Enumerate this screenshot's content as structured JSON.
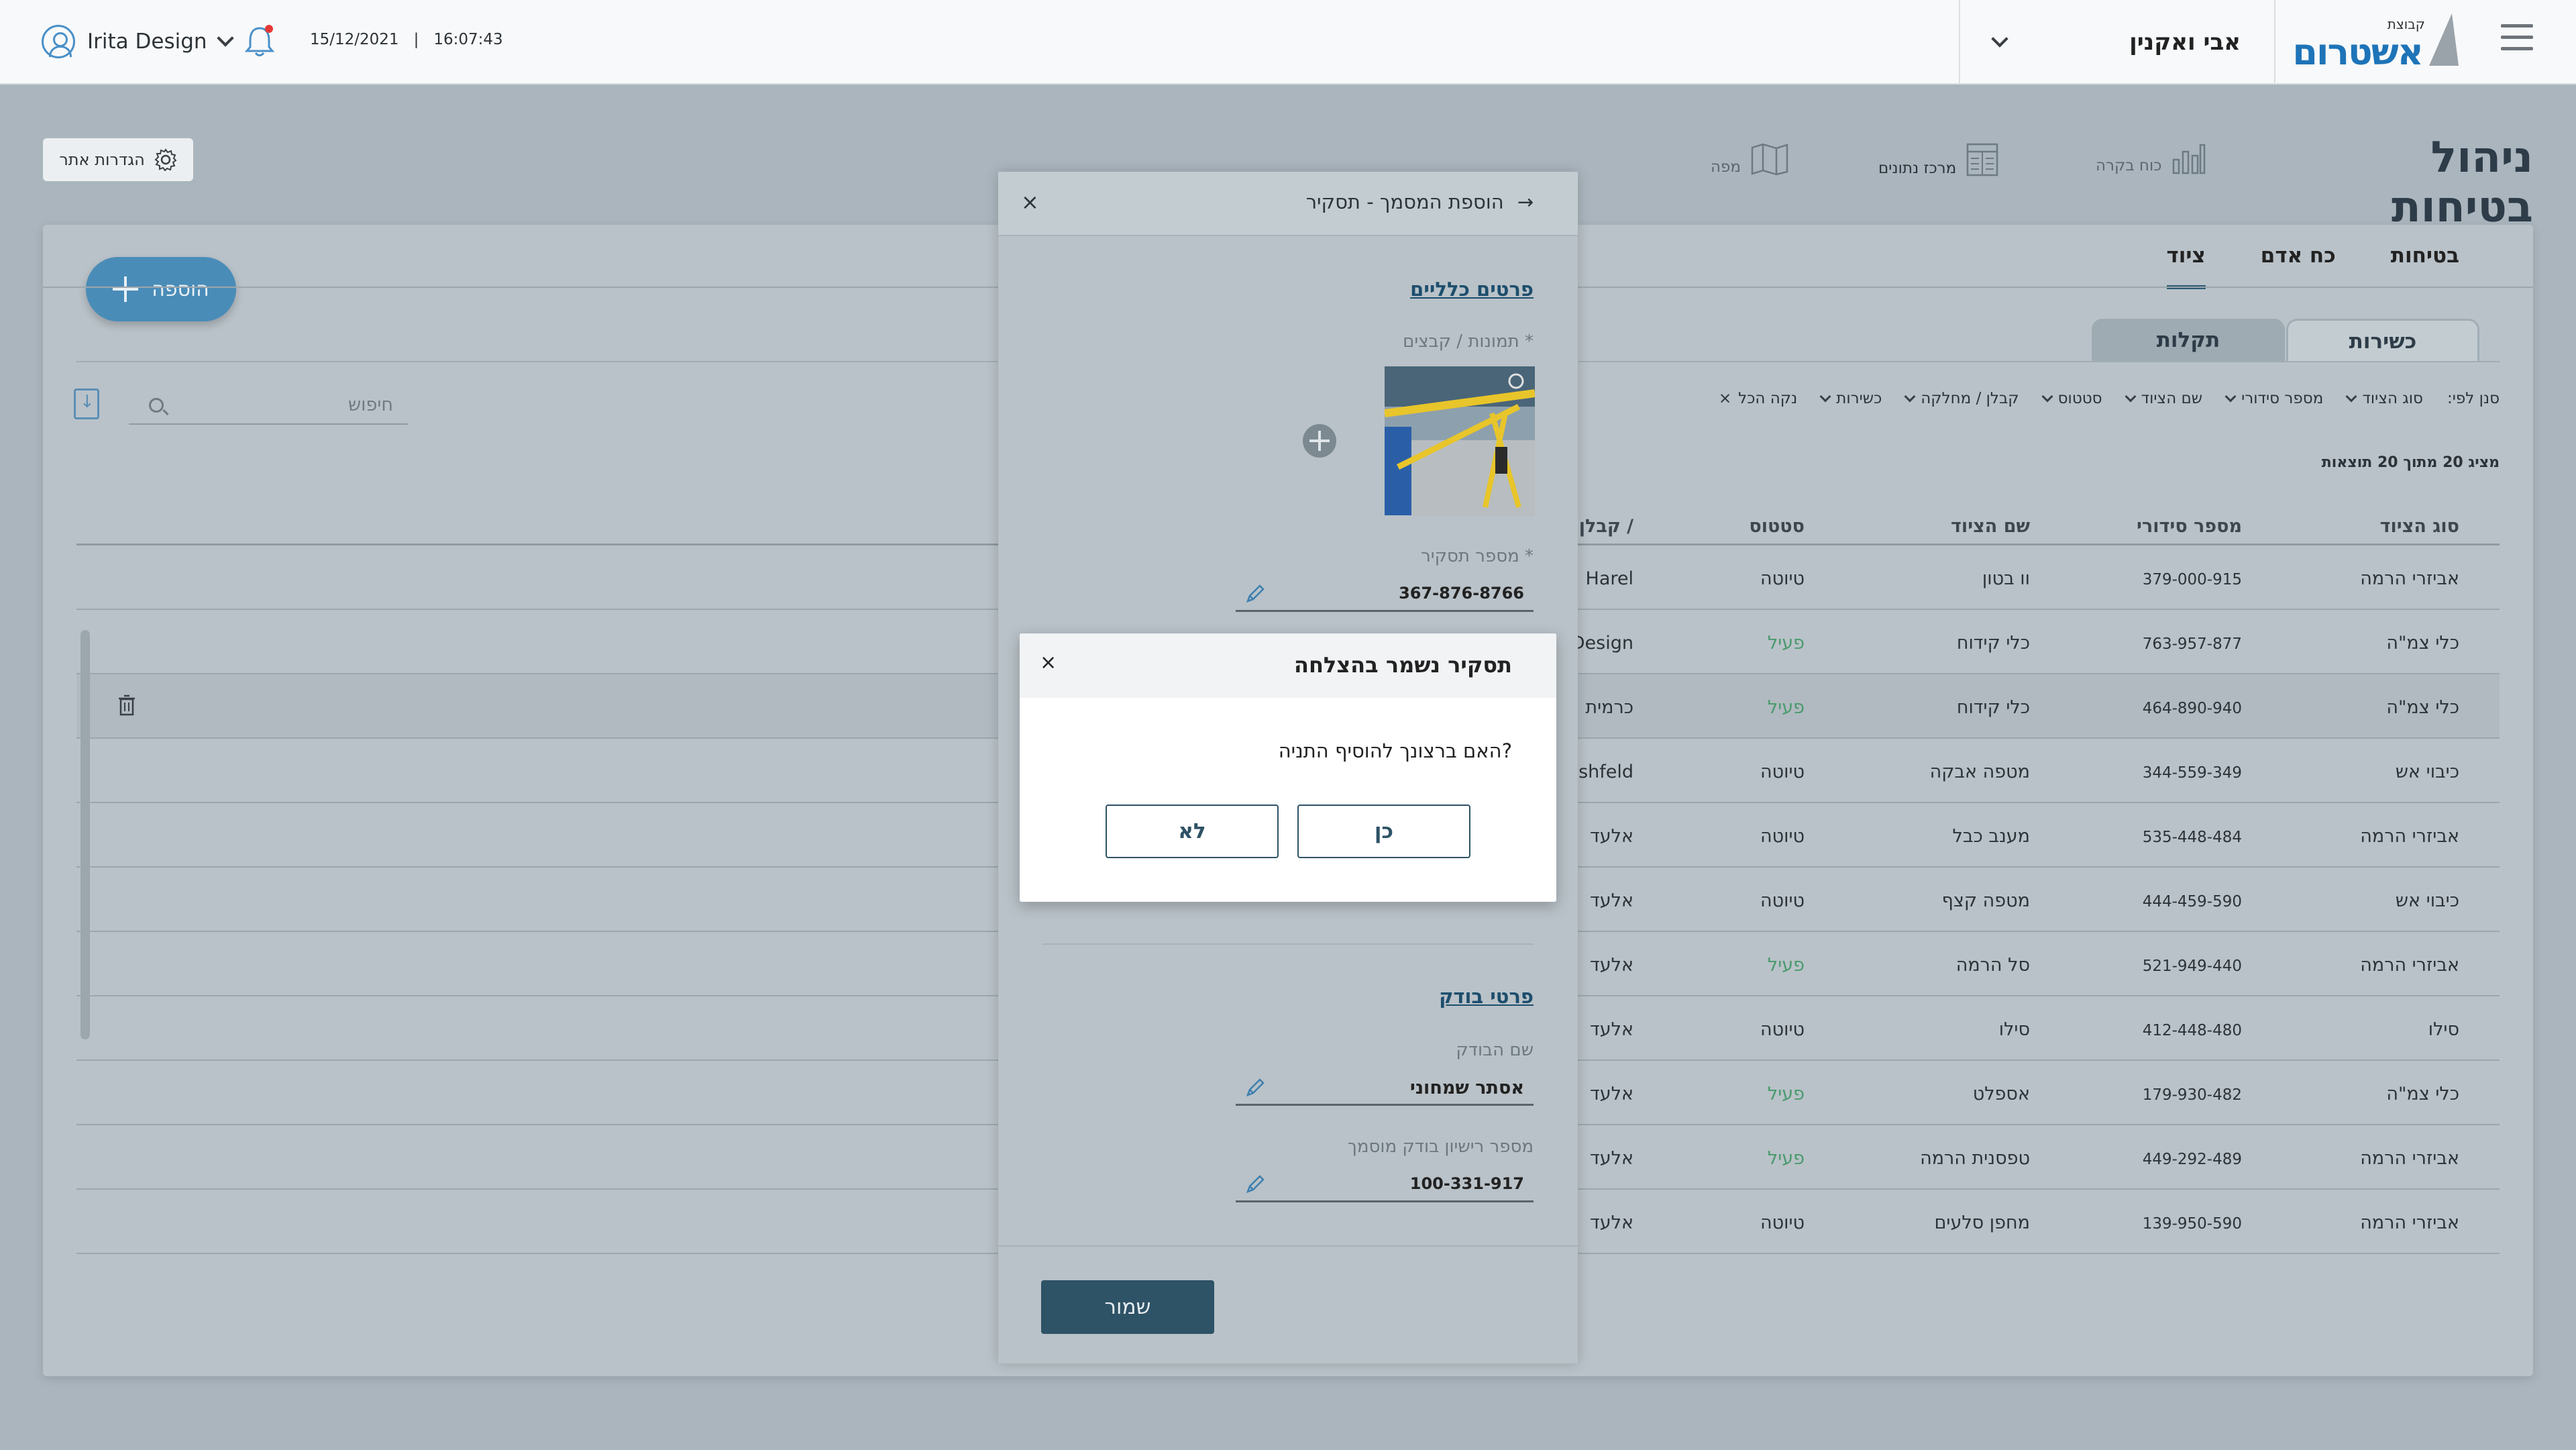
{
  "topbar": {
    "user_name": "Irita Design",
    "date": "15/12/2021",
    "separator": "|",
    "time": "16:07:43",
    "project": "אבי ואקנין",
    "logo_small": "קבוצת",
    "logo_big": "אשטרום",
    "notification_color": "#e53935"
  },
  "page": {
    "title": "ניהול בטיחות",
    "toolbar": [
      {
        "label": "כוח בקרה",
        "icon": "bar-chart-icon"
      },
      {
        "label": "מרכז נתונים",
        "icon": "table-icon"
      },
      {
        "label": "מפה",
        "icon": "map-icon"
      }
    ],
    "settings_label": "הגדרות אתר"
  },
  "tabs": [
    {
      "label": "בטיחות"
    },
    {
      "label": "כח אדם"
    },
    {
      "label": "ציוד"
    }
  ],
  "subtabs": [
    {
      "label": "כשירות"
    },
    {
      "label": "תקלות"
    }
  ],
  "add_button": "הוספה",
  "search": {
    "placeholder": "חיפוש"
  },
  "filters": {
    "prefix": "סנן לפי:",
    "items": [
      "סוג הציוד",
      "מספר סידורי",
      "שם הציוד",
      "סטטוס",
      "קבלן / מחלקה",
      "כשירות"
    ],
    "clear": "נקה הכל"
  },
  "results_text": "מציג 20 מתוך 20 תוצאות",
  "table": {
    "columns": [
      "סוג הציוד",
      "מספר סידורי",
      "שם הציוד",
      "סטטוס",
      "קבלן /"
    ],
    "rows": [
      {
        "type": "אביזרי הרמה",
        "serial": "379-000-915",
        "name": "וו בטון",
        "status": "טיוטה",
        "contractor": "Harel"
      },
      {
        "type": "כלי צמ\"ה",
        "serial": "763-957-877",
        "name": "כלי קידוח",
        "status": "פעיל",
        "contractor": "Design"
      },
      {
        "type": "כלי צמ\"ה",
        "serial": "464-890-940",
        "name": "כלי קידוח",
        "status": "פעיל",
        "contractor": "כרמית"
      },
      {
        "type": "כיבוי אש",
        "serial": "344-559-349",
        "name": "מטפה אבקה",
        "status": "טיוטה",
        "contractor": "shfeld"
      },
      {
        "type": "אביזרי הרמה",
        "serial": "535-448-484",
        "name": "מענב כבל",
        "status": "טיוטה",
        "contractor": "אלעד"
      },
      {
        "type": "כיבוי אש",
        "serial": "444-459-590",
        "name": "מטפה קצף",
        "status": "טיוטה",
        "contractor": "אלעד"
      },
      {
        "type": "אביזרי הרמה",
        "serial": "521-949-440",
        "name": "סל הרמה",
        "status": "פעיל",
        "contractor": "אלעד"
      },
      {
        "type": "סילו",
        "serial": "412-448-480",
        "name": "סילו",
        "status": "טיוטה",
        "contractor": "אלעד"
      },
      {
        "type": "כלי צמ\"ה",
        "serial": "179-930-482",
        "name": "אספלט",
        "status": "פעיל",
        "contractor": "אלעד"
      },
      {
        "type": "אביזרי הרמה",
        "serial": "449-292-489",
        "name": "טפסנית הרמה",
        "status": "פעיל",
        "contractor": "אלעד"
      },
      {
        "type": "אביזרי הרמה",
        "serial": "139-950-590",
        "name": "מחפן סלעים",
        "status": "טיוטה",
        "contractor": "אלעד"
      }
    ]
  },
  "panel": {
    "title": "הוספת המסמך - תסקיר",
    "general_section": "פרטים כלליים",
    "files_label": "תמונות / קבצים *",
    "report_number_label": "מספר תסקיר *",
    "report_number": "367-876-8766",
    "inspector_section": "פרטי בודק",
    "inspector_name_label": "שם הבודק",
    "inspector_name": "אסתר שמחוני",
    "license_label": "מספר רישיון בודק מוסמך",
    "license_number": "100-331-917",
    "save": "שמור"
  },
  "dialog": {
    "title": "תסקיר נשמר בהצלחה",
    "message": "האם ברצונך להוסיף התניה?",
    "yes": "כן",
    "no": "לא"
  }
}
